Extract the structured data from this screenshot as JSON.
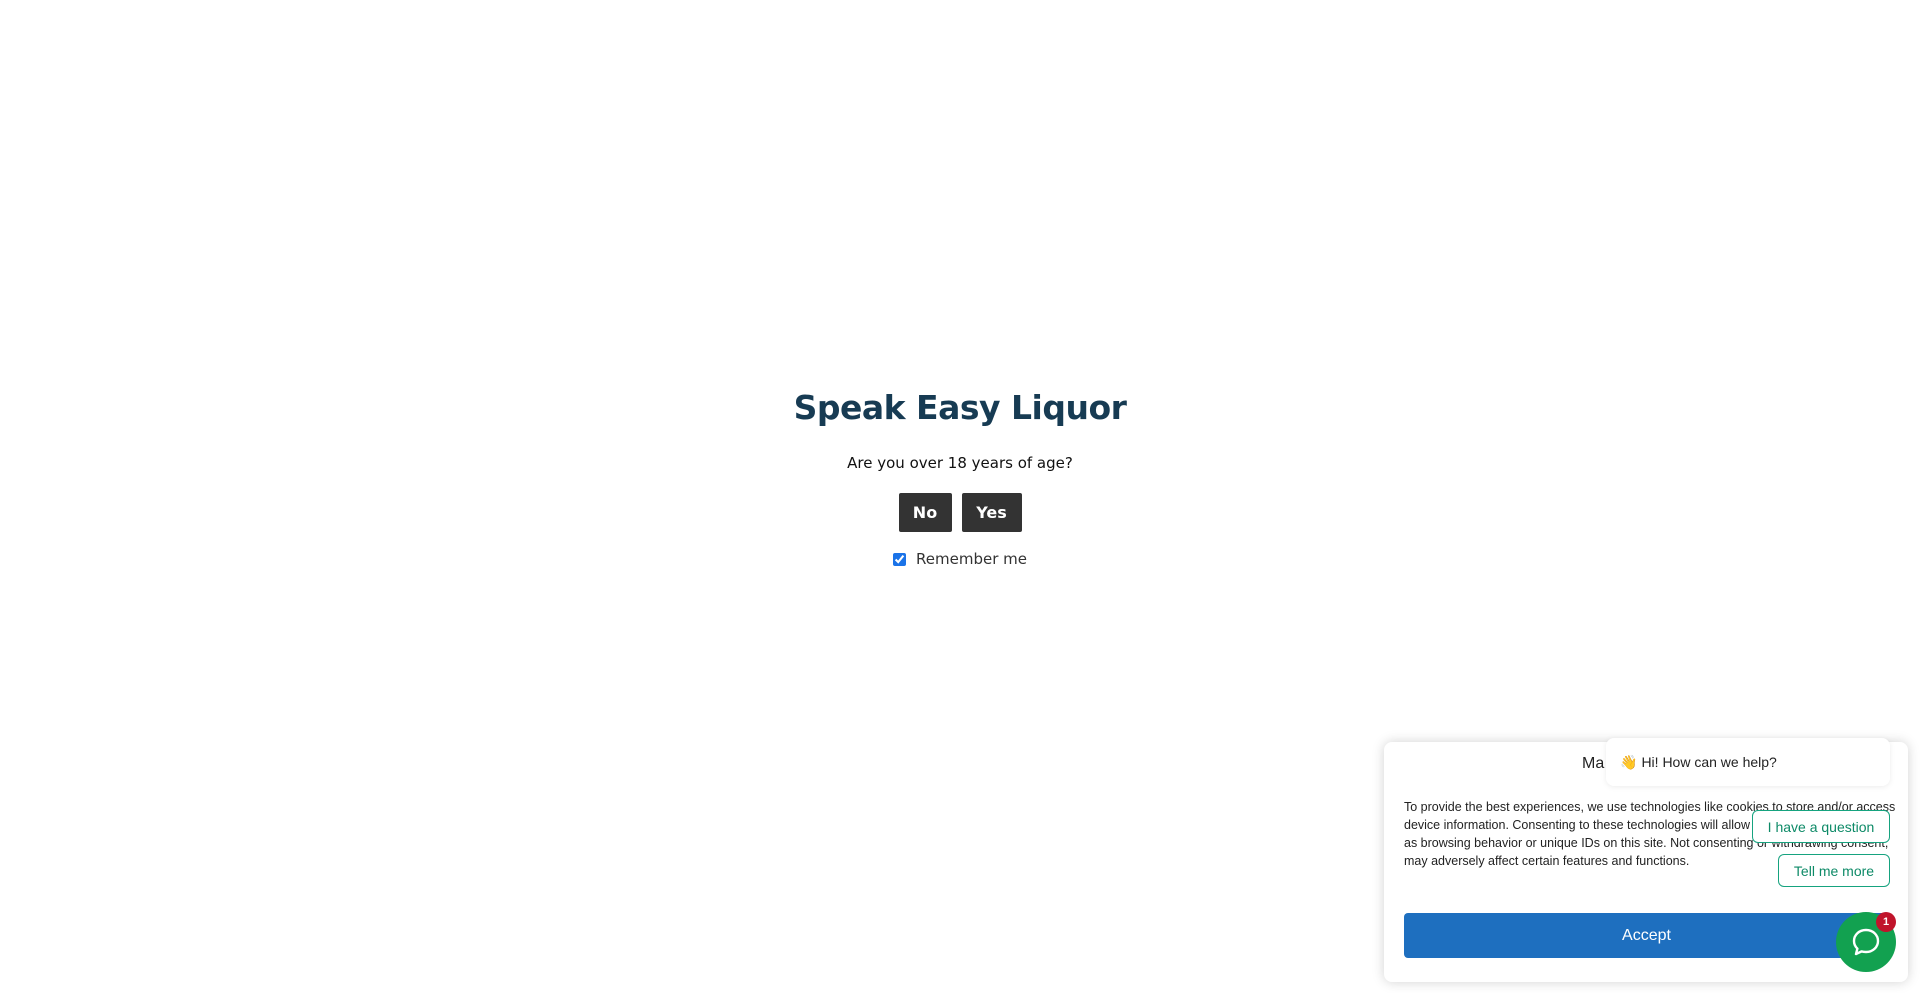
{
  "age_gate": {
    "title": "Speak Easy Liquor",
    "question": "Are you over 18 years of age?",
    "no_label": "No",
    "yes_label": "Yes",
    "remember_label": "Remember me",
    "remember_checked": true
  },
  "cookie_banner": {
    "title_visible": "Ma",
    "body": "To provide the best experiences, we use technologies like cookies to store and/or access device information. Consenting to these technologies will allow us to process data such as browsing behavior or unique IDs on this site. Not consenting or withdrawing consent, may adversely affect certain features and functions.",
    "accept_label": "Accept"
  },
  "chat": {
    "greeting": "Hi! How can we help?",
    "greeting_icon": "waving-hand-icon",
    "options": [
      "I have a question",
      "Tell me more"
    ],
    "launcher_icon": "chat-bubble-icon",
    "badge_count": "1",
    "accent_color": "#12a150"
  },
  "colors": {
    "title": "#173b53",
    "age_buttons": "#333333",
    "accept": "#1e6fbf",
    "badge": "#c0142b"
  }
}
